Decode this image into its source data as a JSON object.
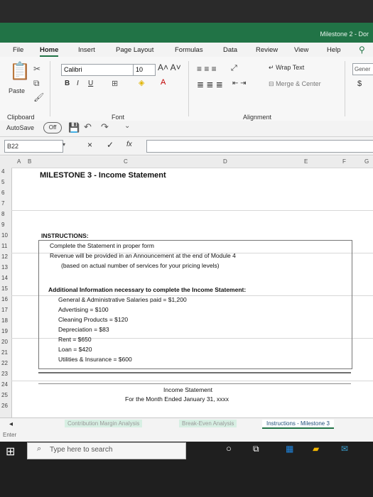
{
  "window": {
    "title": "Milestone 2 - Dor"
  },
  "ribbon_tabs": [
    "File",
    "Home",
    "Insert",
    "Page Layout",
    "Formulas",
    "Data",
    "Review",
    "View",
    "Help"
  ],
  "ribbon": {
    "paste_label": "Paste",
    "clipboard_label": "Clipboard",
    "font_label": "Font",
    "alignment_label": "Alignment",
    "font_name": "Calibri",
    "font_size": "10",
    "wrap_text": "Wrap Text",
    "merge_center": "Merge & Center",
    "number_format": "Gener",
    "currency_symbol": "$"
  },
  "quick_access": {
    "autosave_label": "AutoSave",
    "autosave_state": "Off"
  },
  "formula_bar": {
    "name_box": "B22",
    "fx": "fx",
    "cancel": "×",
    "enter": "✓"
  },
  "columns": [
    "A",
    "B",
    "C",
    "D",
    "E",
    "F",
    "G"
  ],
  "rows": [
    "4",
    "5",
    "6",
    "7",
    "8",
    "9",
    "10",
    "11",
    "12",
    "13",
    "14",
    "15",
    "16",
    "17",
    "18",
    "19",
    "20",
    "21",
    "22",
    "23",
    "24",
    "25",
    "26"
  ],
  "sheet": {
    "title": "MILESTONE 3 - Income Statement",
    "instructions_header": "INSTRUCTIONS:",
    "instructions_1": "Complete the Statement in proper form",
    "instructions_2": "Revenue will be provided in an Announcement at the end of Module 4",
    "instructions_3": "(based on actual number of services for your pricing levels)",
    "additional_header": "Additional Information necessary to complete the Income Statement:",
    "items": [
      "General & Administrative Salaries paid = $1,200",
      "Advertising = $100",
      "Cleaning Products = $120",
      "Depreciation = $83",
      "Rent = $650",
      "Loan = $420",
      "Utilities & Insurance = $600"
    ],
    "statement_title": "Income Statement",
    "statement_period": "For the Month Ended January 31, xxxx"
  },
  "sheet_tabs": [
    "Contribution Margin Analysis",
    "Break-Even Analysis",
    "Instructions - Milestone 3"
  ],
  "status": {
    "mode": "Enter"
  },
  "taskbar": {
    "search_placeholder": "Type here to search"
  },
  "colors": {
    "excel_green": "#217346",
    "sheet_blue": "#1f4e79"
  }
}
